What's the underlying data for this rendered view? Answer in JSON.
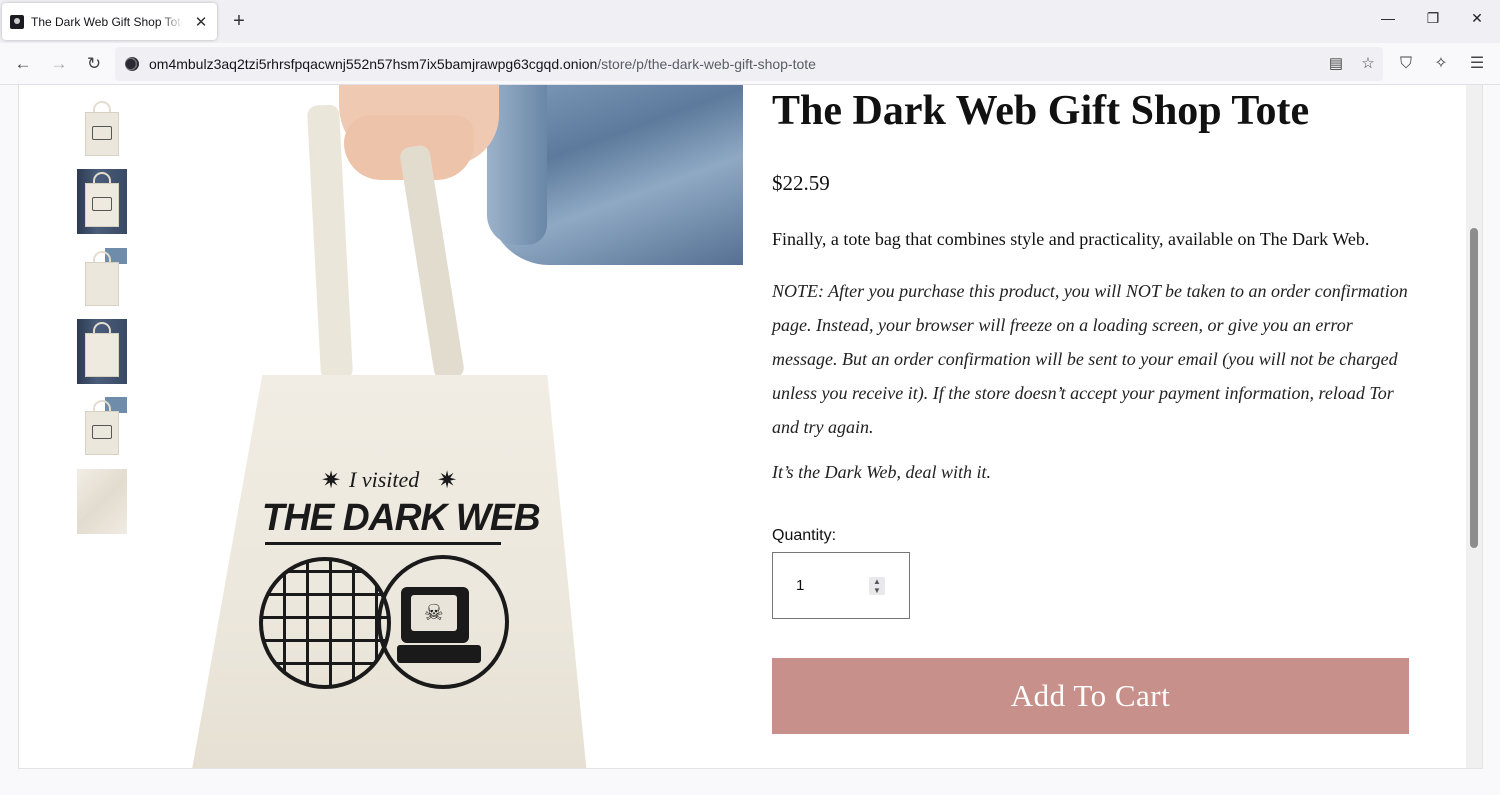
{
  "browser": {
    "tab_title": "The Dark Web Gift Shop Tote — Tor Browser",
    "tab_close": "✕",
    "new_tab": "+",
    "url_host": "om4mbulz3aq2tzi5rhrsfpqacwnj552n57hsm7ix5bamjrawpg63cgqd.onion",
    "url_path": "/store/p/the-dark-web-gift-shop-tote",
    "win_minimize": "—",
    "win_restore": "❐",
    "win_close": "✕",
    "back": "←",
    "forward": "→",
    "reload": "↻",
    "reader": "▤",
    "bookmark": "☆",
    "shield": "⛉",
    "extensions": "✧",
    "menu": "☰"
  },
  "product": {
    "title": "The Dark Web Gift Shop Tote",
    "price": "$22.59",
    "description": "Finally, a tote bag that combines style and practicality, available on The Dark Web.",
    "note": "NOTE: After you purchase this product, you will NOT be taken to an order confirmation page. Instead, your browser will freeze on a loading screen, or give you an error message. But an order confirmation will be sent to your email (you will not be charged unless you receive it). If the store doesn’t accept your payment information, reload Tor and try again.",
    "tagline": "It’s the Dark Web, deal with it.",
    "quantity_label": "Quantity:",
    "quantity_value": "1",
    "add_to_cart": "Add To Cart"
  },
  "bag_print": {
    "line1": "I visited",
    "line2": "THE DARK WEB"
  },
  "colors": {
    "cart_button": "#c8908a",
    "tote": "#ece7dc"
  }
}
